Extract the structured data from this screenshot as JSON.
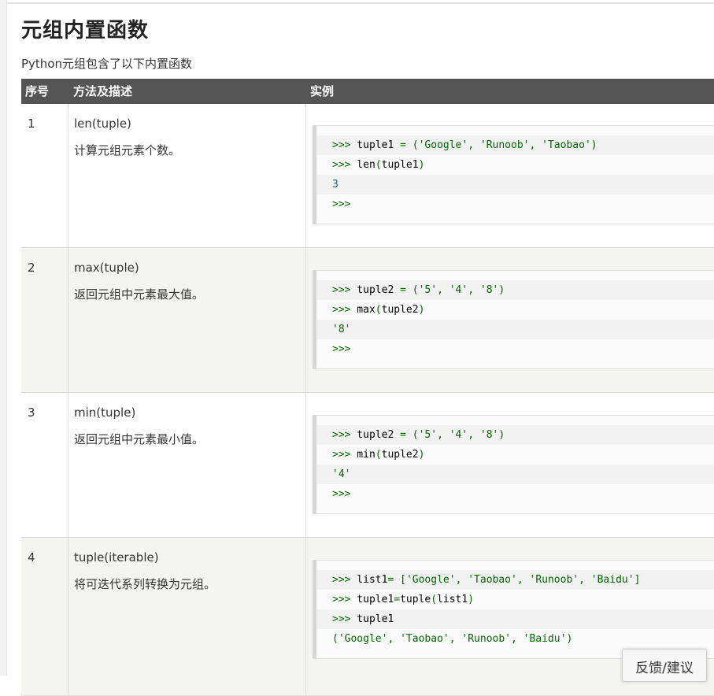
{
  "title": "元组内置函数",
  "intro": "Python元组包含了以下内置函数",
  "table": {
    "headers": [
      "序号",
      "方法及描述",
      "实例"
    ],
    "rows": [
      {
        "idx": "1",
        "fn": "len(tuple)",
        "desc": "计算元组元素个数。",
        "code": [
          ">>> tuple1 = ('Google', 'Runoob', 'Taobao')",
          ">>> len(tuple1)",
          "3",
          ">>>"
        ]
      },
      {
        "idx": "2",
        "fn": "max(tuple)",
        "desc": "返回元组中元素最大值。",
        "code": [
          ">>> tuple2 = ('5', '4', '8')",
          ">>> max(tuple2)",
          "'8'",
          ">>>"
        ]
      },
      {
        "idx": "3",
        "fn": "min(tuple)",
        "desc": "返回元组中元素最小值。",
        "code": [
          ">>> tuple2 = ('5', '4', '8')",
          ">>> min(tuple2)",
          "'4'",
          ">>>"
        ]
      },
      {
        "idx": "4",
        "fn": "tuple(iterable)",
        "desc": "将可迭代系列转换为元组。",
        "code": [
          ">>> list1= ['Google', 'Taobao', 'Runoob', 'Baidu']",
          ">>> tuple1=tuple(list1)",
          ">>> tuple1",
          "('Google', 'Taobao', 'Runoob', 'Baidu')"
        ]
      }
    ]
  },
  "feedback_label": "反馈/建议"
}
